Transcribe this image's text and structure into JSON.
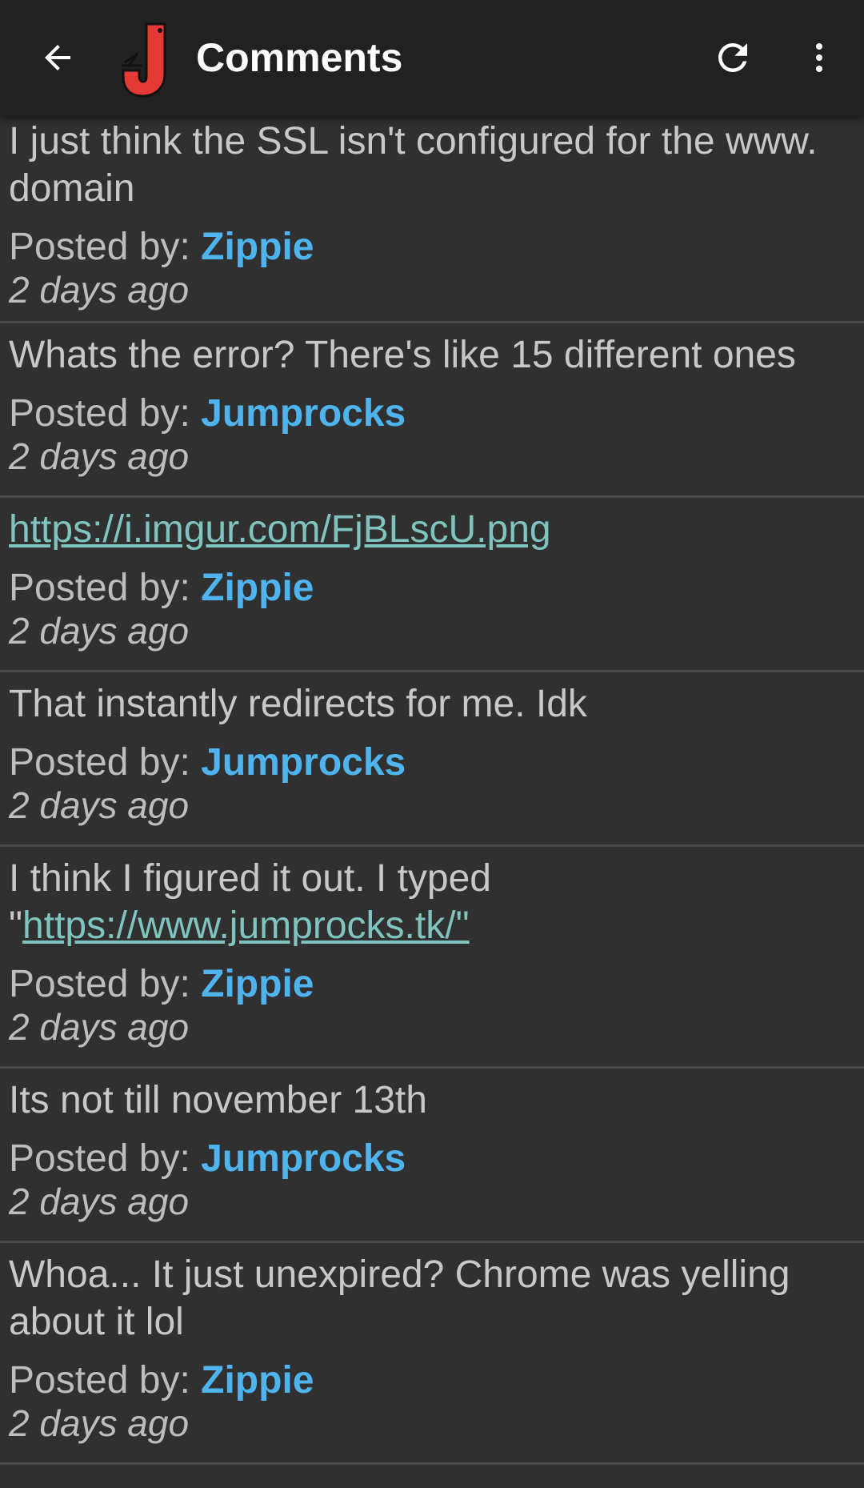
{
  "appbar": {
    "title": "Comments",
    "back_icon": "arrow-back-icon",
    "logo_icon": "app-logo-j-icon",
    "refresh_icon": "refresh-icon",
    "more_icon": "more-vert-icon"
  },
  "colors": {
    "appbar_bg": "#212121",
    "page_bg": "#303030",
    "author": "#4fb3ee",
    "link": "#7fc4bf",
    "logo_red": "#e53935"
  },
  "posted_label": "Posted by: ",
  "comments": [
    {
      "text": "I just think the SSL isn't configured for the www. domain",
      "author": "Zippie",
      "time": "2 days ago"
    },
    {
      "text": "Whats the error? There's like 15 different ones",
      "author": "Jumprocks",
      "time": "2 days ago"
    },
    {
      "text": "",
      "link": "https://i.imgur.com/FjBLscU.png",
      "author": "Zippie",
      "time": "2 days ago"
    },
    {
      "text": "That instantly redirects for me. Idk",
      "author": "Jumprocks",
      "time": "2 days ago"
    },
    {
      "text": "I think I figured it out. I typed \"",
      "link": "https://www.jumprocks.tk/\"",
      "author": "Zippie",
      "time": "2 days ago"
    },
    {
      "text": "Its not till november 13th",
      "author": "Jumprocks",
      "time": "2 days ago"
    },
    {
      "text": "Whoa... It just unexpired? Chrome was yelling about it lol",
      "author": "Zippie",
      "time": "2 days ago"
    }
  ]
}
